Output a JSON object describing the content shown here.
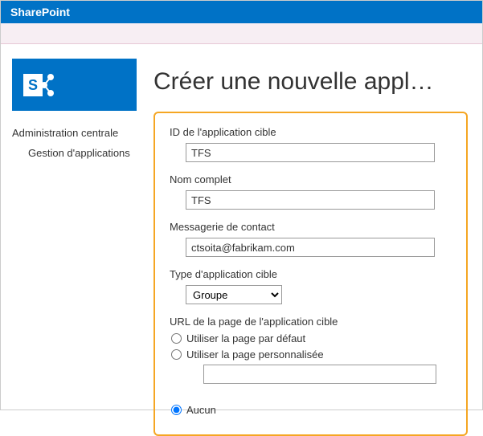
{
  "header": {
    "product": "SharePoint"
  },
  "sidebar": {
    "link_admin": "Administration centrale",
    "link_apps": "Gestion d'applications"
  },
  "page": {
    "title": "Créer une nouvelle appl…"
  },
  "form": {
    "app_id_label": "ID de l'application cible",
    "app_id_value": "TFS",
    "display_name_label": "Nom complet",
    "display_name_value": "TFS",
    "email_label": "Messagerie de contact",
    "email_value": "ctsoita@fabrikam.com",
    "app_type_label": "Type d'application cible",
    "app_type_value": "Groupe",
    "url_section_label": "URL de la page de l'application cible",
    "radio_default": "Utiliser la page par défaut",
    "radio_custom": "Utiliser la page personnalisée",
    "radio_none": "Aucun"
  }
}
